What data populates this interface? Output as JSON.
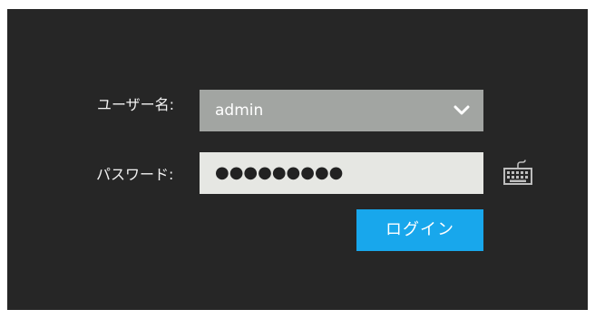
{
  "form": {
    "username_label": "ユーザー名:",
    "username_value": "admin",
    "password_label": "パスワード:",
    "password_value": "●●●●●●●●●",
    "login_label": "ログイン"
  },
  "icons": {
    "dropdown": "chevron-down-icon",
    "keyboard": "keyboard-icon"
  },
  "colors": {
    "background": "#262626",
    "select_bg": "#a2a5a2",
    "password_bg": "#e6e7e3",
    "login_button": "#18a7ec"
  }
}
